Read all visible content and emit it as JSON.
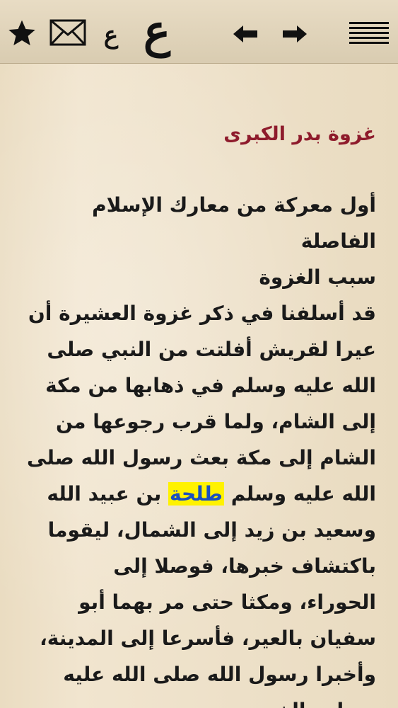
{
  "toolbar": {
    "menu_icon": "hamburger-menu-icon",
    "forward_icon": "arrow-right-icon",
    "back_icon": "arrow-left-icon",
    "font_increase_glyph": "ع",
    "font_decrease_glyph": "ع",
    "mail_icon": "envelope-icon",
    "favorite_icon": "star-icon"
  },
  "article": {
    "title": "غزوة بدر الكبرى",
    "lines": [
      "أول معركة من معارك الإسلام",
      "الفاصلة",
      "سبب الغزوة",
      "قد أسلفنا في ذكر غزوة العشيرة أن",
      "عيرا لقريش أفلتت من النبي صلى",
      "الله عليه وسلم في ذهابها من مكة",
      "إلى الشام، ولما قرب رجوعها من",
      "الشام إلى مكة بعث رسول الله صلى",
      "",
      "وسعيد بن زيد إلى الشمال، ليقوما",
      "باكتشاف خبرها، فوصلا إلى",
      "الحوراء، ومكثا حتى مر بهما أبو",
      "سفيان بالعير، فأسرعا إلى المدينة،",
      "وأخبرا رسول الله صلى الله عليه",
      "وسلم بالخبر."
    ],
    "line9_before": "الله عليه وسلم",
    "line9_highlight": "طلحة",
    "line9_after": "بن عبيد الله"
  },
  "colors": {
    "title": "#8e1b2c",
    "highlight_bg": "#fff200",
    "highlight_text": "#1a4fc0",
    "page_bg": "#efe3cd"
  }
}
